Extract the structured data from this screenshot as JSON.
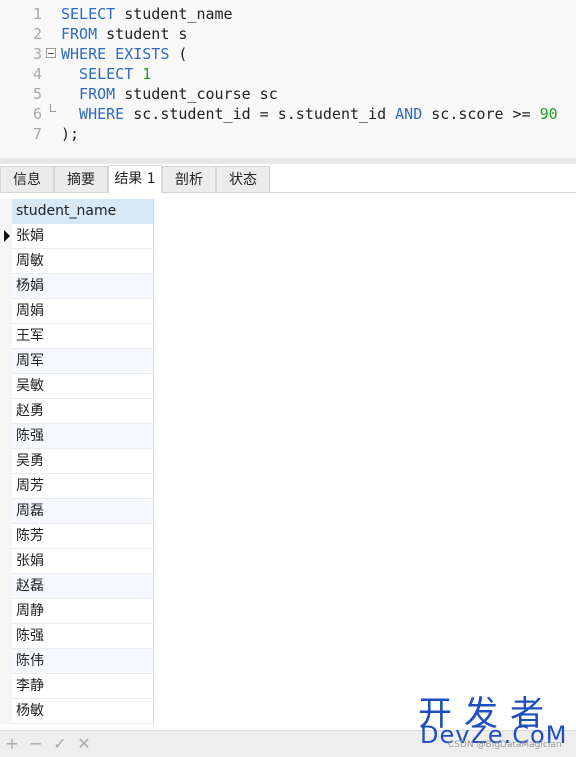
{
  "editor": {
    "lines": [
      {
        "num": "1",
        "tokens": [
          {
            "t": "SELECT",
            "c": "kw"
          },
          {
            "t": " student_name",
            "c": "txt"
          }
        ]
      },
      {
        "num": "2",
        "tokens": [
          {
            "t": "FROM",
            "c": "kw"
          },
          {
            "t": " student s",
            "c": "txt"
          }
        ]
      },
      {
        "num": "3",
        "tokens": [
          {
            "t": "WHERE EXISTS",
            "c": "kw"
          },
          {
            "t": " (",
            "c": "txt"
          }
        ]
      },
      {
        "num": "4",
        "tokens": [
          {
            "t": "  SELECT",
            "c": "kw"
          },
          {
            "t": " ",
            "c": "txt"
          },
          {
            "t": "1",
            "c": "num"
          }
        ]
      },
      {
        "num": "5",
        "tokens": [
          {
            "t": "  FROM",
            "c": "kw"
          },
          {
            "t": " student_course sc",
            "c": "txt"
          }
        ]
      },
      {
        "num": "6",
        "tokens": [
          {
            "t": "  WHERE",
            "c": "kw"
          },
          {
            "t": " sc.student_id = s.student_id ",
            "c": "txt"
          },
          {
            "t": "AND",
            "c": "kw"
          },
          {
            "t": " sc.score >= ",
            "c": "txt"
          },
          {
            "t": "90",
            "c": "num"
          }
        ]
      },
      {
        "num": "7",
        "tokens": [
          {
            "t": ");",
            "c": "txt"
          }
        ]
      }
    ]
  },
  "tabs": [
    {
      "label": "信息",
      "active": false
    },
    {
      "label": "摘要",
      "active": false
    },
    {
      "label": "结果 1",
      "active": true
    },
    {
      "label": "剖析",
      "active": false
    },
    {
      "label": "状态",
      "active": false
    }
  ],
  "result": {
    "column": "student_name",
    "rows": [
      "张娟",
      "周敏",
      "杨娟",
      "周娟",
      "王军",
      "周军",
      "吴敏",
      "赵勇",
      "陈强",
      "吴勇",
      "周芳",
      "周磊",
      "陈芳",
      "张娟",
      "赵磊",
      "周静",
      "陈强",
      "陈伟",
      "李静",
      "杨敏"
    ]
  },
  "toolbar": {
    "buttons": [
      {
        "name": "add-row-icon",
        "glyph": "+"
      },
      {
        "name": "delete-row-icon",
        "glyph": "−"
      },
      {
        "name": "apply-icon",
        "glyph": "✓"
      },
      {
        "name": "cancel-icon",
        "glyph": "✕"
      }
    ]
  },
  "watermark": {
    "top": "开发者",
    "bottom": "DevZe.CoM",
    "small": "CSDN @BigDataMagician"
  },
  "colors": {
    "keyword": "#2f6bbd",
    "number": "#22a022",
    "header_bg": "#d7e8f6",
    "watermark": "#1f4fbf"
  }
}
